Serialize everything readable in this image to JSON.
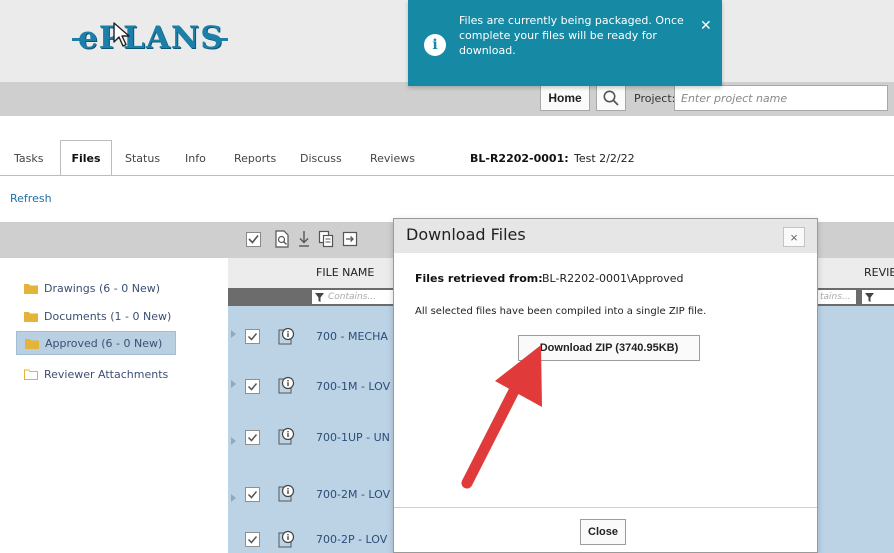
{
  "colors": {
    "accent": "#1689a4",
    "logo": "#1c7fa8",
    "row_selected": "#bcd3e6",
    "arrow": "#e03a3a",
    "link": "#1f6ea5"
  },
  "header": {
    "logo_text": "ePLANS",
    "home_label": "Home",
    "search_icon": "search-icon",
    "project_label": "Project:",
    "project_placeholder": "Enter project name"
  },
  "tabs": [
    {
      "label": "Tasks"
    },
    {
      "label": "Files",
      "active": true
    },
    {
      "label": "Status"
    },
    {
      "label": "Info"
    },
    {
      "label": "Reports"
    },
    {
      "label": "Discuss"
    },
    {
      "label": "Reviews"
    }
  ],
  "record": {
    "number": "BL-R2202-0001:",
    "title": "Test 2/2/22"
  },
  "actions": {
    "refresh_label": "Refresh"
  },
  "folders": [
    {
      "label": "Drawings (6 - 0 New)",
      "icon": "folder-icon"
    },
    {
      "label": "Documents (1 - 0 New)",
      "icon": "folder-icon"
    },
    {
      "label": "Approved (6 - 0 New)",
      "icon": "folder-icon",
      "selected": true
    },
    {
      "label": "Reviewer Attachments",
      "icon": "folder-outline-icon"
    }
  ],
  "grid": {
    "columns": {
      "file_name": "FILE NAME",
      "reviews": "REVIE"
    },
    "filter_placeholder": "Contains...",
    "filter_placeholder_right": "tains...",
    "rows": [
      {
        "file_name": "700 - MECHA"
      },
      {
        "file_name": "700-1M - LOV"
      },
      {
        "file_name": "700-1UP - UN"
      },
      {
        "file_name": "700-2M - LOV"
      },
      {
        "file_name": "700-2P - LOV"
      }
    ]
  },
  "dialog": {
    "title": "Download Files",
    "close_glyph": "×",
    "retrieved_label": "Files retrieved from:",
    "retrieved_path": "BL-R2202-0001\\Approved",
    "compiled_message": "All selected files have been compiled into a single ZIP file.",
    "download_button": "Download ZIP (3740.95KB)",
    "close_button": "Close"
  },
  "toast": {
    "icon_glyph": "i",
    "message": "Files are currently being packaged. Once complete your files will be ready for download.",
    "close_glyph": "✕"
  }
}
